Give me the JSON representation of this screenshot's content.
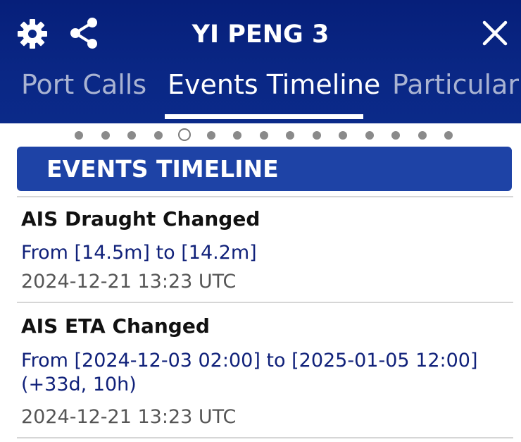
{
  "header": {
    "title": "YI PENG 3",
    "settings_icon": "gear-icon",
    "share_icon": "share-icon",
    "close_icon": "close-icon",
    "background_color": "#0a2785"
  },
  "tabs": [
    {
      "label": "Port Calls",
      "active": false
    },
    {
      "label": "Events Timeline",
      "active": true
    },
    {
      "label": "Particular",
      "active": false
    }
  ],
  "pager": {
    "total": 15,
    "current_index": 4
  },
  "section": {
    "title": "EVENTS TIMELINE",
    "color": "#1e43a6"
  },
  "events": [
    {
      "title": "AIS Draught Changed",
      "detail": "From [14.5m] to [14.2m]",
      "time": "2024-12-21 13:23 UTC"
    },
    {
      "title": "AIS ETA Changed",
      "detail": "From [2024-12-03 02:00] to [2025-01-05 12:00] (+33d, 10h)",
      "time": "2024-12-21 13:23 UTC"
    }
  ]
}
